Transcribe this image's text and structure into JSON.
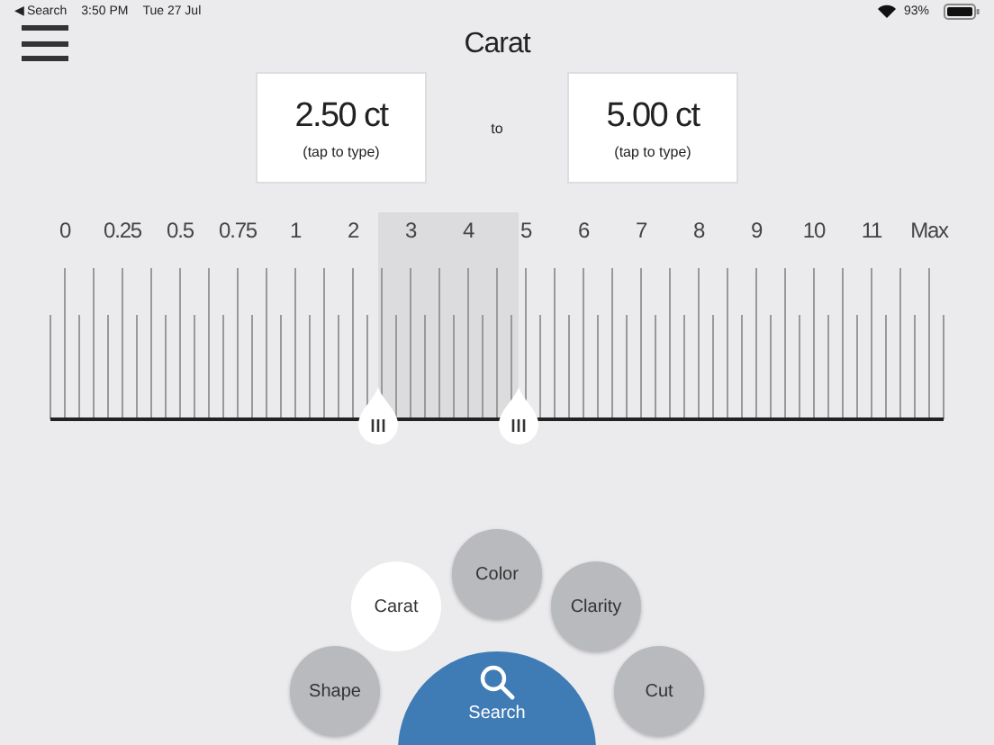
{
  "status_bar": {
    "back": "◀ Search",
    "time": "3:50 PM",
    "date": "Tue 27 Jul",
    "battery": "93%"
  },
  "title": "Carat",
  "range": {
    "from": {
      "value": "2.50 ct",
      "hint": "(tap to type)"
    },
    "separator": "to",
    "to": {
      "value": "5.00 ct",
      "hint": "(tap to type)"
    }
  },
  "scale": {
    "labels": [
      "0",
      "0.25",
      "0.5",
      "0.75",
      "1",
      "2",
      "3",
      "4",
      "5",
      "6",
      "7",
      "8",
      "9",
      "10",
      "11",
      "Max"
    ],
    "low_thumb": {
      "level": 0.367
    },
    "high_thumb": {
      "level": 0.524
    }
  },
  "filters": [
    {
      "label": "Shape",
      "selected": false
    },
    {
      "label": "Carat",
      "selected": true
    },
    {
      "label": "Color",
      "selected": false
    },
    {
      "label": "Clarity",
      "selected": false
    },
    {
      "label": "Cut",
      "selected": false
    }
  ],
  "search_button": {
    "label": "Search"
  }
}
